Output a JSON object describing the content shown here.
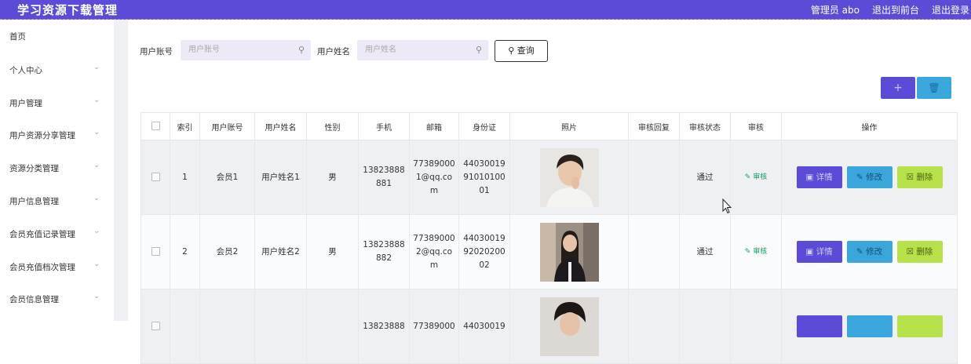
{
  "app": {
    "title": "学习资源下载管理"
  },
  "topnav": {
    "admin": "管理员 abo",
    "to_front": "退出到前台",
    "logout": "退出登录"
  },
  "sidebar": {
    "items": [
      {
        "label": "首页"
      },
      {
        "label": "个人中心"
      },
      {
        "label": "用户管理"
      },
      {
        "label": "用户资源分享管理"
      },
      {
        "label": "资源分类管理"
      },
      {
        "label": "用户信息管理"
      },
      {
        "label": "会员充值记录管理"
      },
      {
        "label": "会员充值档次管理"
      },
      {
        "label": "会员信息管理"
      }
    ]
  },
  "search": {
    "account_label": "用户账号",
    "account_placeholder": "用户账号",
    "name_label": "用户姓名",
    "name_placeholder": "用户姓名",
    "query_label": "查询"
  },
  "toolbar": {
    "add_icon": "plus-icon",
    "delete_icon": "trash-icon"
  },
  "table": {
    "headers": [
      "索引",
      "用户账号",
      "用户姓名",
      "性别",
      "手机",
      "邮箱",
      "身份证",
      "照片",
      "审核回复",
      "审核状态",
      "审核",
      "操作"
    ],
    "rows": [
      {
        "index": "1",
        "account": "会员1",
        "name": "用户姓名1",
        "gender": "男",
        "phone": "13823888881",
        "email": "773890001@qq.com",
        "id_card": "440300199101010001",
        "reply": "",
        "status": "通过",
        "audit": "审核"
      },
      {
        "index": "2",
        "account": "会员2",
        "name": "用户姓名2",
        "gender": "男",
        "phone": "13823888882",
        "email": "773890002@qq.com",
        "id_card": "440300199202020002",
        "reply": "",
        "status": "通过",
        "audit": "审核"
      },
      {
        "index": "",
        "account": "",
        "name": "",
        "gender": "",
        "phone": "13823888",
        "email": "77389000",
        "id_card": "44030019",
        "reply": "",
        "status": "",
        "audit": ""
      }
    ],
    "actions": {
      "detail": "详情",
      "edit": "修改",
      "delete": "删除"
    }
  },
  "colors": {
    "primary": "#5b4bd6",
    "info": "#3aa6dc",
    "danger": "#b6e14a",
    "success": "#1aa06b"
  }
}
